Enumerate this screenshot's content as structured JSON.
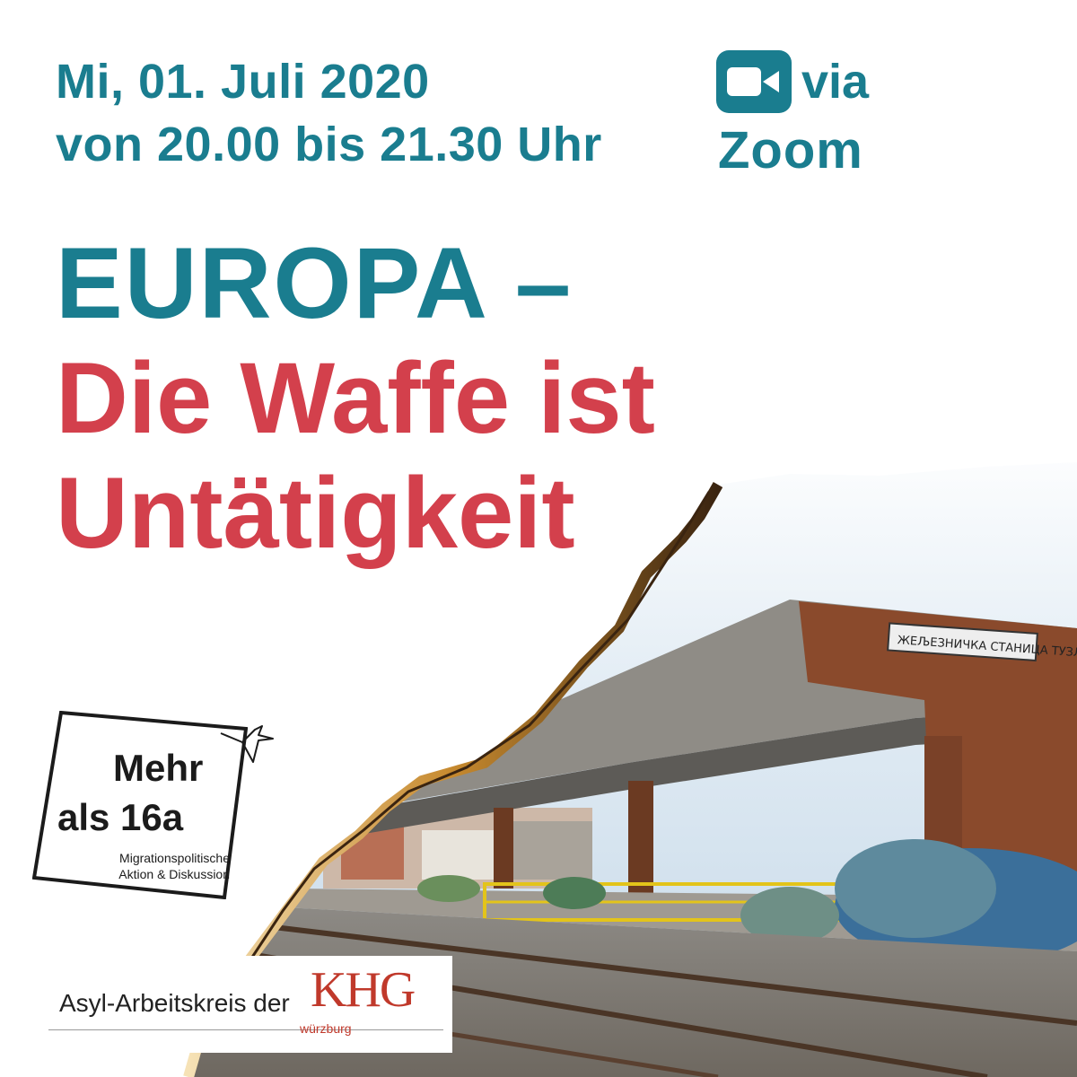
{
  "header": {
    "date_line": "Mi, 01. Juli 2020",
    "time_line": "von 20.00 bis 21.30 Uhr"
  },
  "online": {
    "icon": "video-camera-icon",
    "via": "via",
    "platform": "Zoom"
  },
  "title": {
    "line1": "EUROPA –",
    "line2": "Die Waffe ist",
    "line3": "Untätigkeit"
  },
  "photo": {
    "station_sign": "ЖЕЉЕЗНИЧКА СТАНИЦА ТУЗЛА"
  },
  "logo_16a": {
    "line1": "Mehr",
    "line2": "als 16a",
    "sub1": "Migrationspolitische",
    "sub2": "Aktion & Diskussion",
    "icon": "origami-bird-icon"
  },
  "logo_khg": {
    "text": "Asyl-Arbeitskreis der",
    "mark": "KHG",
    "sub": "würzburg"
  },
  "colors": {
    "teal": "#1a7d8f",
    "red": "#d3404c",
    "rust": "#8a4a2c"
  }
}
